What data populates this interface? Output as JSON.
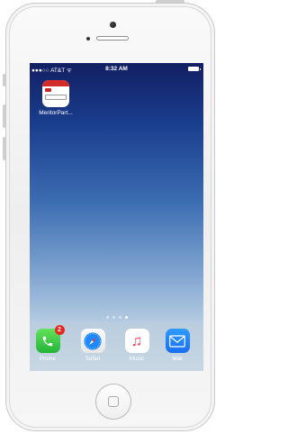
{
  "statusbar": {
    "carrier": "●●●○○ AT&T ᯤ",
    "time": "8:32 AM"
  },
  "home": {
    "apps": [
      {
        "label": "MeritorPart..."
      }
    ],
    "page_indicator": {
      "pages": 4,
      "active": 3
    }
  },
  "dock": {
    "apps": [
      {
        "label": "Phone",
        "icon": "phone-icon",
        "badge": "2"
      },
      {
        "label": "Safari",
        "icon": "safari-icon"
      },
      {
        "label": "Music",
        "icon": "music-icon"
      },
      {
        "label": "Mail",
        "icon": "mail-icon"
      }
    ]
  },
  "colors": {
    "wallpaper_top": "#121f63",
    "wallpaper_bottom": "#d3e1ec",
    "badge": "#e8281f"
  }
}
